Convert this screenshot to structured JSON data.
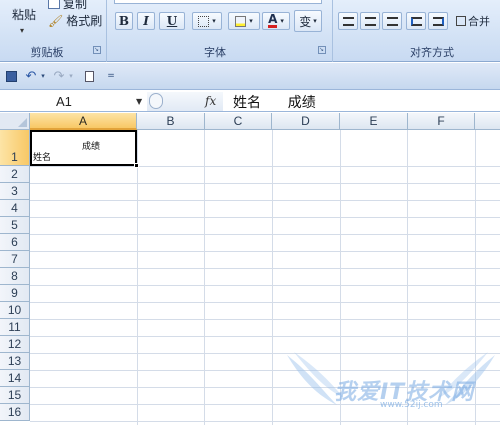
{
  "ribbon": {
    "clipboard": {
      "paste_label": "粘贴",
      "copy_label": "复制",
      "format_painter_label": "格式刷",
      "group_label": "剪贴板"
    },
    "font": {
      "bold": "B",
      "italic": "I",
      "underline": "U",
      "font_color_glyph": "A",
      "phonetic_glyph": "变",
      "group_label": "字体"
    },
    "alignment": {
      "merge_label": "合并",
      "group_label": "对齐方式"
    }
  },
  "formula_bar": {
    "name_box": "A1",
    "fx": "fx",
    "content": "姓名      成绩"
  },
  "sheet": {
    "columns": [
      "A",
      "B",
      "C",
      "D",
      "E",
      "F"
    ],
    "rows": [
      "1",
      "2",
      "3",
      "4",
      "5",
      "6",
      "7",
      "8",
      "9",
      "10",
      "11",
      "12",
      "13",
      "14",
      "15",
      "16"
    ],
    "active_cell": "A1",
    "a1_line1": "成绩",
    "a1_line2": "姓名"
  },
  "watermark": {
    "text": "我爱IT技术网",
    "url": "www.52ij.com"
  }
}
